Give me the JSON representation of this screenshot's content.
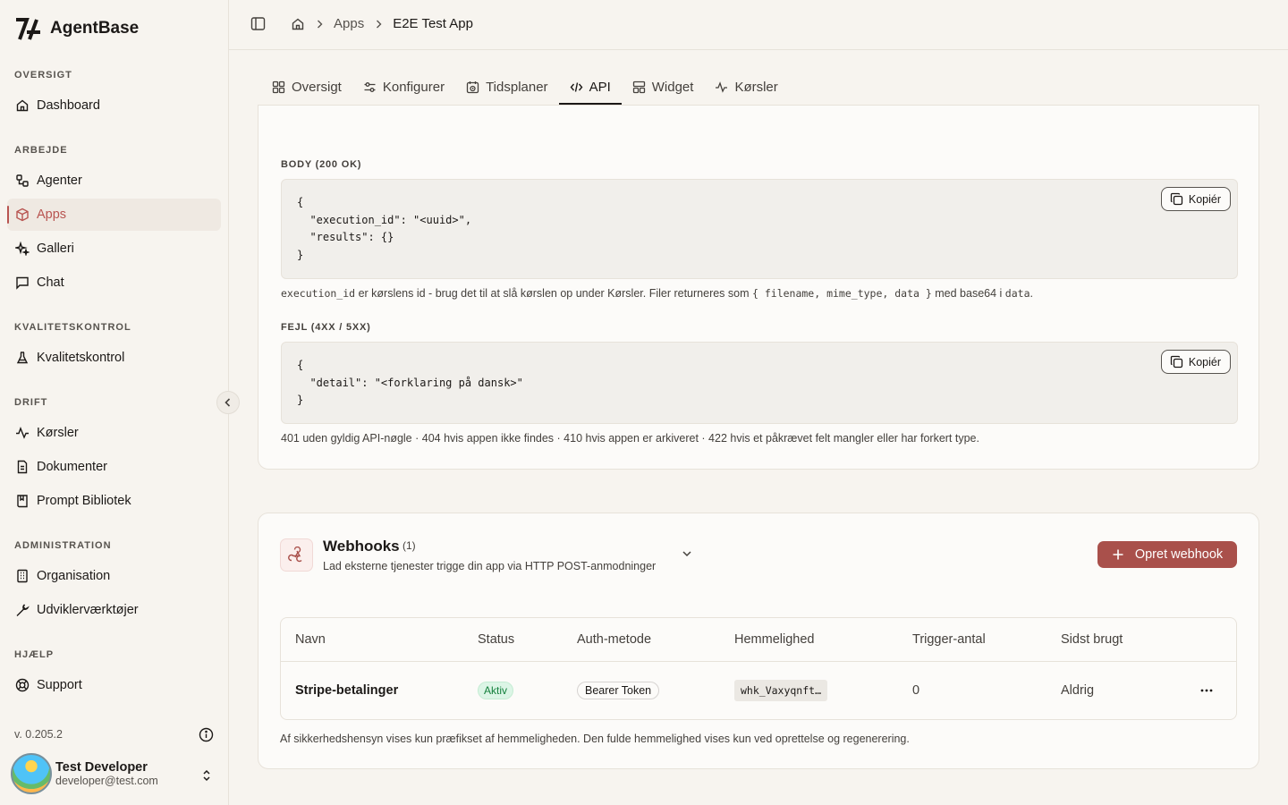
{
  "app": {
    "name": "AgentBase"
  },
  "sidebar": {
    "sections": {
      "oversigt": "OVERSIGT",
      "arbejde": "ARBEJDE",
      "kvalitet": "KVALITETSKONTROL",
      "drift": "DRIFT",
      "administration": "ADMINISTRATION",
      "hjaelp": "HJÆLP"
    },
    "items": {
      "dashboard": "Dashboard",
      "agenter": "Agenter",
      "apps": "Apps",
      "galleri": "Galleri",
      "chat": "Chat",
      "kvalitetskontrol": "Kvalitetskontrol",
      "korsler": "Kørsler",
      "dokumenter": "Dokumenter",
      "prompt": "Prompt Bibliotek",
      "organisation": "Organisation",
      "udvikler": "Udviklerværktøjer",
      "support": "Support"
    },
    "active_item": "Apps",
    "version": "v. 0.205.2",
    "user": {
      "name": "Test Developer",
      "email": "developer@test.com"
    }
  },
  "breadcrumb": {
    "apps": "Apps",
    "current": "E2E Test App"
  },
  "tabs": {
    "oversigt": "Oversigt",
    "konfigurer": "Konfigurer",
    "tidsplaner": "Tidsplaner",
    "api": "API",
    "widget": "Widget",
    "korsler": "Kørsler",
    "active": "API"
  },
  "api": {
    "body_label": "BODY (200 OK)",
    "body_code": "{\n  \"execution_id\": \"<uuid>\",\n  \"results\": {}\n}",
    "copy_label": "Kopiér",
    "body_note": {
      "code1": "execution_id",
      "text1": " er kørslens id - brug det til at slå kørslen op under Kørsler. Filer returneres som ",
      "code2": "{ filename, mime_type, data }",
      "text2": " med base64 i ",
      "code3": "data",
      "text3": "."
    },
    "error_label": "FEJL (4XX / 5XX)",
    "error_code": "{\n  \"detail\": \"<forklaring på dansk>\"\n}",
    "error_note": "401 uden gyldig API-nøgle · 404 hvis appen ikke findes · 410 hvis appen er arkiveret · 422 hvis et påkrævet felt mangler eller har forkert type."
  },
  "webhooks": {
    "title": "Webhooks",
    "count": "(1)",
    "subtitle": "Lad eksterne tjenester trigge din app via HTTP POST-anmodninger",
    "create_label": "Opret webhook",
    "columns": [
      "Navn",
      "Status",
      "Auth-metode",
      "Hemmelighed",
      "Trigger-antal",
      "Sidst brugt"
    ],
    "rows": [
      {
        "name": "Stripe-betalinger",
        "status": "Aktiv",
        "auth": "Bearer Token",
        "secret": "whk_Vaxyqnft…",
        "triggers": "0",
        "last_used": "Aldrig"
      }
    ],
    "note": "Af sikkerhedshensyn vises kun præfikset af hemmeligheden. Den fulde hemmelighed vises kun ved oprettelse og regenerering."
  },
  "colors": {
    "accent": "#a9504b",
    "active_nav": "#b85450",
    "status_green": "#15803d",
    "background": "#f7f4ef"
  }
}
